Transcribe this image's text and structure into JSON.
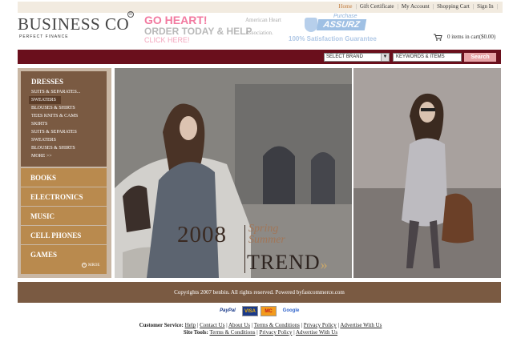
{
  "topnav": {
    "items": [
      "Home",
      "Gift Certificate",
      "My Account",
      "Shopping Cart",
      "Sign In"
    ]
  },
  "header": {
    "logo": "BUSINESS CO",
    "reg": "R",
    "tagline": "PERFECT FINANCE",
    "ad_heart": {
      "line1": "GO HEART!",
      "line2": "ORDER TODAY & HELP",
      "line3": "CLICK HERE!",
      "right1": "American Heart",
      "right2": "Association."
    },
    "ad_assurz": {
      "small": "Purchase",
      "brand": "ASSURZ",
      "guarantee": "100% Satisfaction Guarantee"
    },
    "cart_text": "0 items in cart($0.00)"
  },
  "search": {
    "brand_select": "SELECT BRAND",
    "keywords_value": "KEYWORDS & ITEMS",
    "button": "Search"
  },
  "sidenav": {
    "dresses_label": "DRESSES",
    "sub_items": [
      "SUITS & SEPARATES...",
      "SWEATERS",
      "BLOUSES & SHIRTS",
      "TEES KNITS & CAMS",
      "SKIRTS",
      "SUITS & SEPARATES",
      "SWEATERS",
      "BLOUSES & SHIRTS",
      "MORE >>"
    ],
    "categories": [
      "BOOKS",
      "ELECTRONICS",
      "MUSIC",
      "CELL PHONES",
      "GAMES"
    ],
    "more_label": "MROE"
  },
  "banner": {
    "year": "2008",
    "season1": "Spring",
    "season2": "Summer",
    "trend": "TREND",
    "trend_chev": "»"
  },
  "footer": {
    "copyright": "Copyrights 2007 benbin.  All rights reserved.     Powered byfastcommerce.com",
    "pay_paypal": "PayPal",
    "pay_visa": "VISA",
    "pay_mc": "MC",
    "pay_google": "Google",
    "customer_service_label": "Customer Service:",
    "customer_links": [
      "Help",
      "Contact Us",
      "About Us",
      "Terms & Conditions",
      "Privacy Policy",
      "Advertise With Us"
    ],
    "site_tools_label": "Site Tools:",
    "site_links": [
      "Terms & Conditions",
      "Privacy Policy",
      "Advertise With Us"
    ]
  },
  "colors": {
    "accent_maroon": "#6a0f1c",
    "brown": "#7a5a42",
    "tan": "#b98a4e",
    "active_link": "#c07a3a"
  }
}
